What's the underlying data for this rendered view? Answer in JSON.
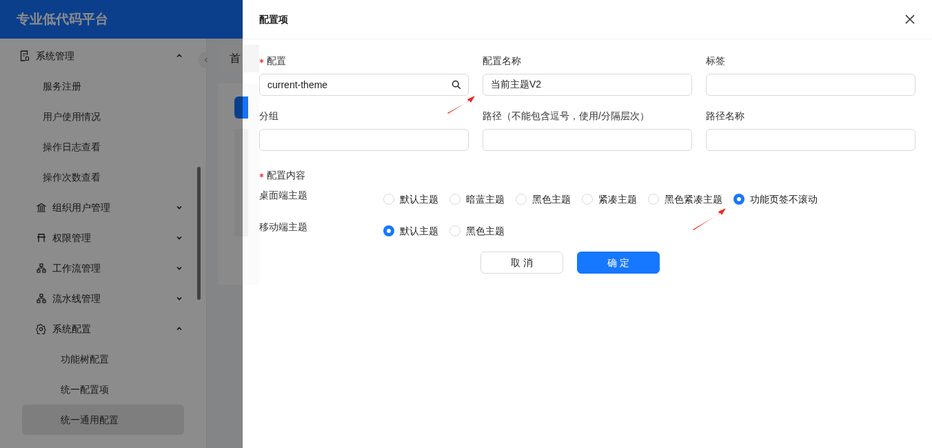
{
  "app": {
    "title": "专业低代码平台"
  },
  "sidebar": {
    "items": [
      {
        "label": "系统管理",
        "expanded": true,
        "selected": false,
        "children": [
          {
            "label": "服务注册",
            "selected": false
          },
          {
            "label": "用户使用情况",
            "selected": false
          },
          {
            "label": "操作日志查看",
            "selected": false
          },
          {
            "label": "操作次数查看",
            "selected": false
          },
          {
            "label": "组织用户管理",
            "expanded": false,
            "selected": false
          },
          {
            "label": "权限管理",
            "expanded": false,
            "selected": false
          },
          {
            "label": "工作流管理",
            "expanded": false,
            "selected": false
          },
          {
            "label": "流水线管理",
            "expanded": false,
            "selected": false
          },
          {
            "label": "系统配置",
            "expanded": true,
            "selected": false,
            "children": [
              {
                "label": "功能树配置",
                "selected": false
              },
              {
                "label": "统一配置项",
                "selected": false
              },
              {
                "label": "统一通用配置",
                "selected": true
              }
            ]
          }
        ]
      }
    ]
  },
  "main": {
    "tabs": [
      {
        "label": "首",
        "selected": true
      }
    ]
  },
  "drawer": {
    "title": "配置项",
    "fields": [
      {
        "label": "配置",
        "required": true,
        "kind": "search",
        "value": "current-theme"
      },
      {
        "label": "配置名称",
        "required": false,
        "kind": "text",
        "value": "当前主题V2"
      },
      {
        "label": "标签",
        "required": false,
        "kind": "text"
      },
      {
        "label": "分组",
        "required": false,
        "kind": "text"
      },
      {
        "label": "路径（不能包含逗号，使用/分隔层次）",
        "required": false,
        "kind": "text"
      },
      {
        "label": "路径名称",
        "required": false,
        "kind": "text"
      }
    ],
    "content": {
      "label": "配置内容",
      "required": true,
      "groups": [
        {
          "label": "桌面端主题",
          "options": [
            {
              "label": "默认主题",
              "selected": false
            },
            {
              "label": "暗蓝主题",
              "selected": false
            },
            {
              "label": "黑色主题",
              "selected": false
            },
            {
              "label": "紧凑主题",
              "selected": false
            },
            {
              "label": "黑色紧凑主题",
              "selected": false
            },
            {
              "label": "功能页签不滚动",
              "selected": true
            }
          ]
        },
        {
          "label": "移动端主题",
          "options": [
            {
              "label": "默认主题",
              "selected": true
            },
            {
              "label": "黑色主题",
              "selected": false
            }
          ]
        }
      ]
    },
    "buttons": [
      {
        "label": "取 消",
        "kind": "secondary"
      },
      {
        "label": "确 定",
        "kind": "primary"
      }
    ]
  }
}
